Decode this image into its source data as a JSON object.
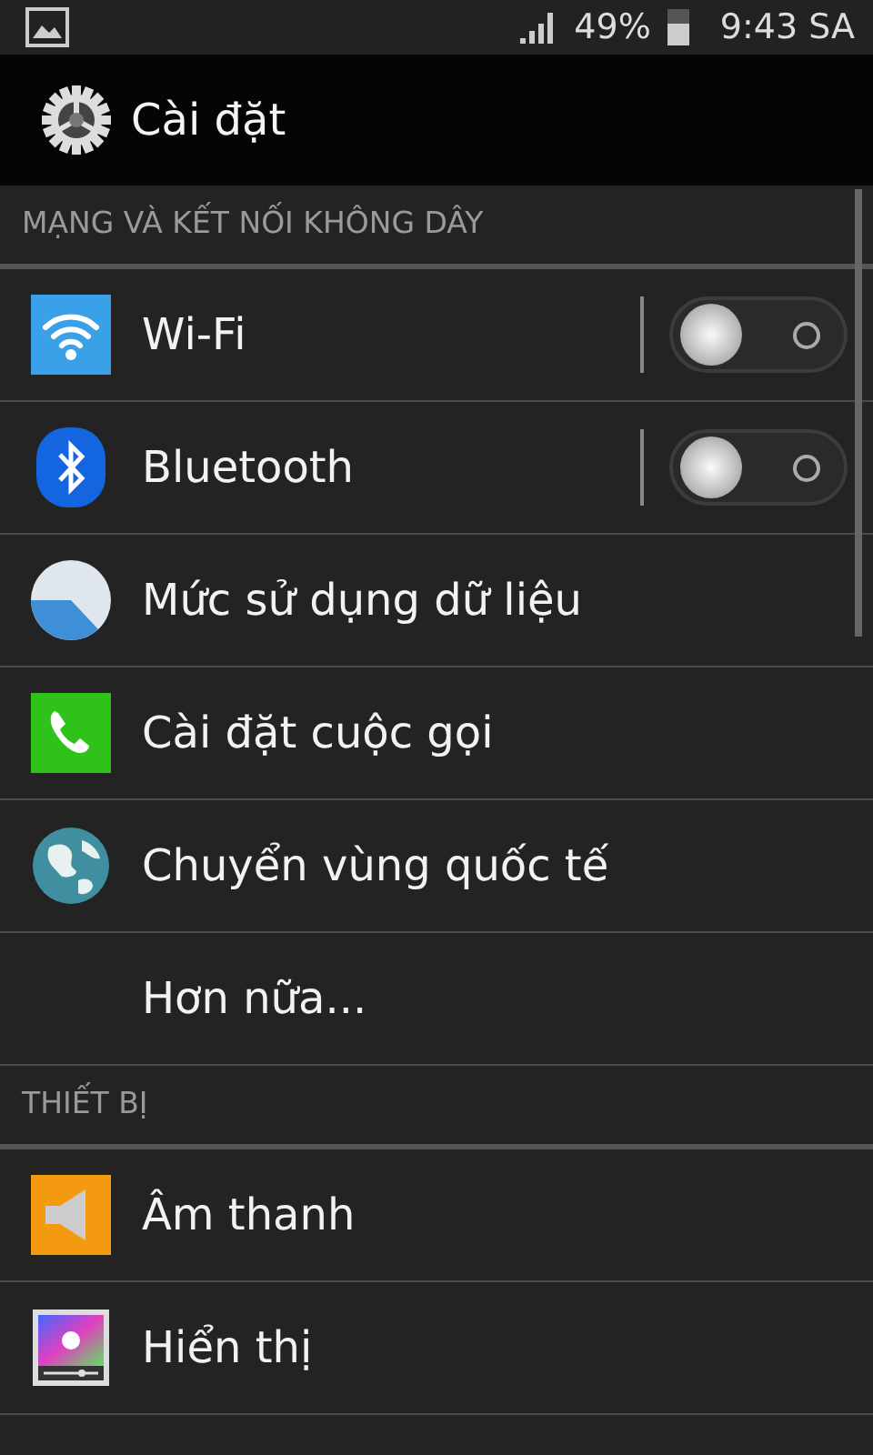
{
  "status_bar": {
    "battery": "49%",
    "time": "9:43 SA"
  },
  "action_bar": {
    "title": "Cài đặt"
  },
  "sections": [
    {
      "header": "MẠNG VÀ KẾT NỐI KHÔNG DÂY",
      "items": [
        {
          "kind": "toggle",
          "label": "Wi-Fi",
          "on": false
        },
        {
          "kind": "toggle",
          "label": "Bluetooth",
          "on": false
        },
        {
          "kind": "link",
          "label": "Mức sử dụng dữ liệu"
        },
        {
          "kind": "link",
          "label": "Cài đặt cuộc gọi"
        },
        {
          "kind": "link",
          "label": "Chuyển vùng quốc tế"
        },
        {
          "kind": "link",
          "label": "Hơn nữa..."
        }
      ]
    },
    {
      "header": "THIẾT BỊ",
      "items": [
        {
          "kind": "link",
          "label": "Âm thanh"
        },
        {
          "kind": "link",
          "label": "Hiển thị"
        }
      ]
    }
  ]
}
